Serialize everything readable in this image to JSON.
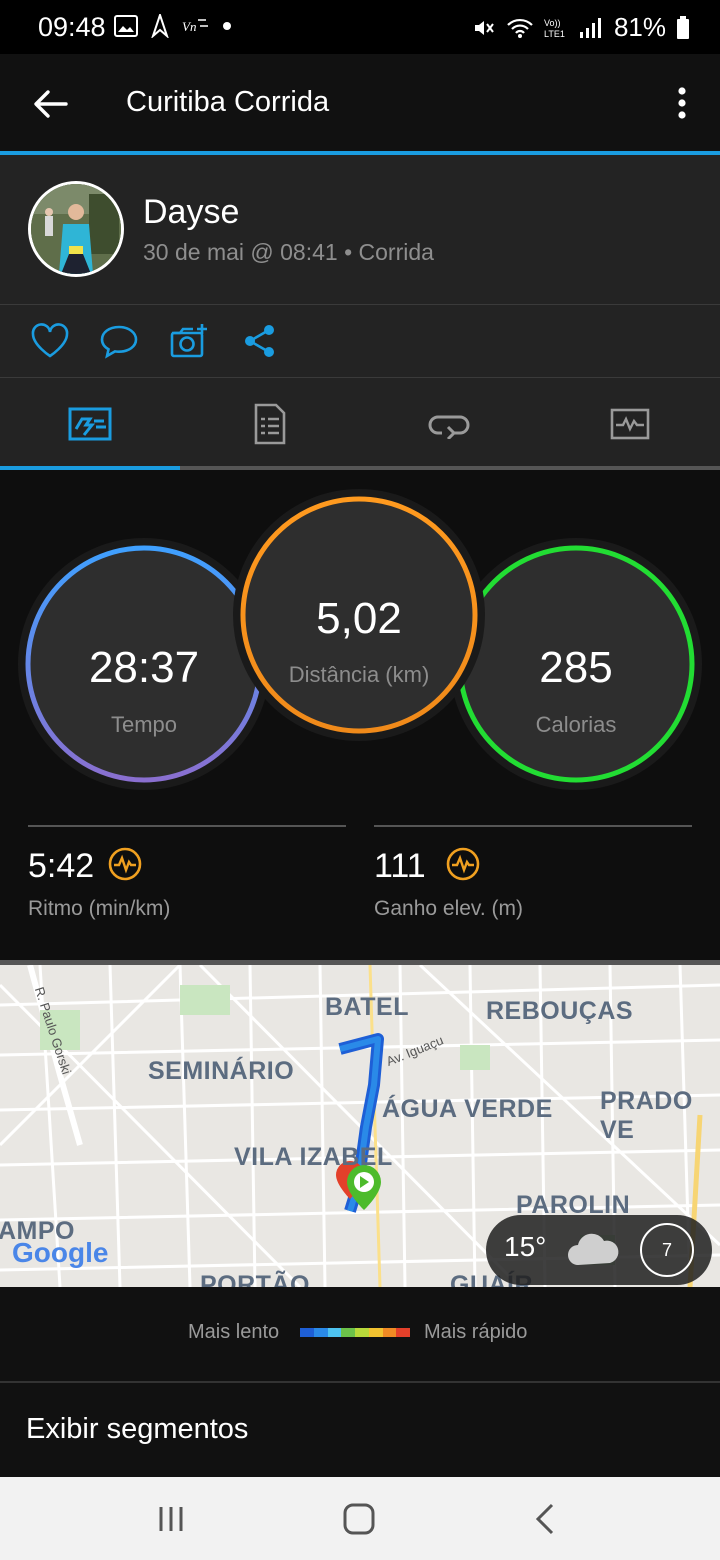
{
  "status_bar": {
    "time": "09:48",
    "battery": "81%",
    "network": "LTE1"
  },
  "app_bar": {
    "title": "Curitiba Corrida",
    "back_icon": "arrow-back-icon",
    "menu_icon": "more-vert-icon"
  },
  "profile": {
    "name": "Dayse",
    "meta": "30 de mai @ 08:41 • Corrida"
  },
  "actions": [
    "heart-icon",
    "comment-icon",
    "add-photo-icon",
    "share-icon"
  ],
  "tabs": [
    "stats-tab",
    "details-tab",
    "laps-tab",
    "charts-tab"
  ],
  "stats": {
    "tempo": {
      "value": "28:37",
      "label": "Tempo"
    },
    "distancia": {
      "value": "5,02",
      "label": "Distância (km)"
    },
    "calorias": {
      "value": "285",
      "label": "Calorias"
    },
    "ritmo": {
      "value": "5:42",
      "label": "Ritmo (min/km)"
    },
    "ganho": {
      "value": "111",
      "label": "Ganho elev. (m)"
    }
  },
  "map": {
    "labels": {
      "batel": "BATEL",
      "reboucas": "REBOUÇAS",
      "seminario": "SEMINÁRIO",
      "agua_verde": "ÁGUA VERDE",
      "prado": "PRADO VE",
      "vila_izabel": "VILA IZABEL",
      "parolin": "PAROLIN",
      "campo": "AMPO",
      "portao": "PORTÃO",
      "guaira": "GUAÍR",
      "street1": "R. Paulo Gorski",
      "street2": "Av. Iguaçu",
      "google": "Google"
    },
    "weather": {
      "temp": "15°",
      "wind": "7"
    }
  },
  "legend": {
    "slow": "Mais lento",
    "fast": "Mais rápido",
    "colors": [
      "#1e5fd6",
      "#2a8ae8",
      "#4ec3f0",
      "#6cc24a",
      "#b8d93a",
      "#f2c230",
      "#f08a24",
      "#e3402a"
    ]
  },
  "segments": {
    "label": "Exibir segmentos"
  },
  "colors": {
    "accent": "#1a9ce0",
    "tempo_ring": "#3fa0ff",
    "distance_ring": "#ff9a1f",
    "calories_ring": "#22dd33"
  }
}
